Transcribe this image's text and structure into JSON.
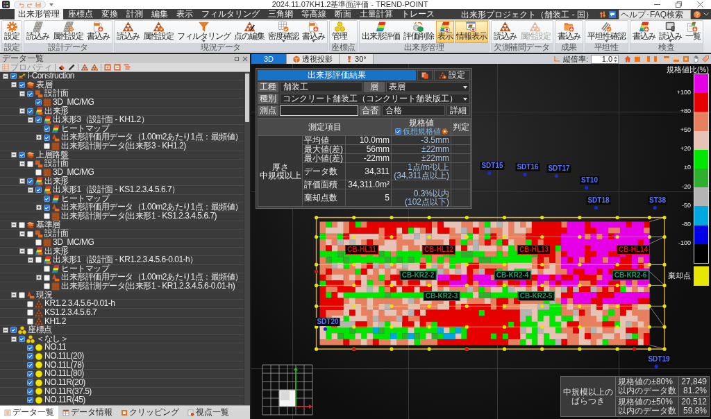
{
  "title_bar": {
    "title": "2024.11.07KH1.2基準面評価 - TREND-POINT"
  },
  "ribbon_tabs": [
    {
      "label": "出来形管理",
      "selected": true
    },
    {
      "label": "座標点",
      "selected": false
    },
    {
      "label": "変換",
      "selected": false
    },
    {
      "label": "計測",
      "selected": false
    },
    {
      "label": "編集",
      "selected": false
    },
    {
      "label": "表示",
      "selected": false
    },
    {
      "label": "フィルタリング",
      "selected": false
    },
    {
      "label": "三角網",
      "selected": false
    },
    {
      "label": "等高線",
      "selected": false
    },
    {
      "label": "断面",
      "selected": false
    },
    {
      "label": "土量計算",
      "selected": false
    },
    {
      "label": "トレース",
      "selected": false
    }
  ],
  "header_right": {
    "project": "出来形プロジェクト（舗装工 - 国）",
    "search": {
      "placeholder": "ヘルプ･FAQ検索"
    }
  },
  "ribbon_groups": [
    {
      "label": "設定",
      "buttons": [
        {
          "label": "設定",
          "on": false,
          "disabled": false,
          "dropdown": false
        }
      ]
    },
    {
      "label": "設計データ",
      "buttons": [
        {
          "label": "読込み",
          "on": false,
          "disabled": false,
          "dropdown": false
        },
        {
          "label": "属性設定",
          "on": false,
          "disabled": false,
          "dropdown": false
        },
        {
          "label": "書込み",
          "on": false,
          "disabled": false,
          "dropdown": false
        }
      ]
    },
    {
      "label": "現況データ",
      "buttons": [
        {
          "label": "読込み",
          "on": false,
          "disabled": false,
          "dropdown": false
        },
        {
          "label": "属性設定",
          "on": false,
          "disabled": false,
          "dropdown": false
        },
        {
          "label": "フィルタリング",
          "on": false,
          "disabled": false,
          "dropdown": true
        },
        {
          "label": "点の編集",
          "on": false,
          "disabled": false,
          "dropdown": false
        },
        {
          "label": "密度確認",
          "on": false,
          "disabled": false,
          "dropdown": true
        },
        {
          "label": "書込み",
          "on": false,
          "disabled": false,
          "dropdown": true
        }
      ]
    },
    {
      "label": "座標点",
      "buttons": [
        {
          "label": "管理",
          "on": false,
          "disabled": false,
          "dropdown": false
        }
      ]
    },
    {
      "label": "出来形管理",
      "buttons": [
        {
          "label": "出来形評価",
          "on": false,
          "disabled": false,
          "dropdown": false
        },
        {
          "label": "評価削除",
          "on": false,
          "disabled": false,
          "dropdown": false
        },
        {
          "label": "表示",
          "on": true,
          "disabled": false,
          "dropdown": false
        },
        {
          "label": "情報表示",
          "on": true,
          "disabled": false,
          "dropdown": false
        }
      ]
    },
    {
      "label": "欠測補間データ",
      "buttons": [
        {
          "label": "読込み",
          "on": false,
          "disabled": false,
          "dropdown": false
        },
        {
          "label": "属性設定",
          "on": false,
          "disabled": true,
          "dropdown": false
        }
      ]
    },
    {
      "label": "成果",
      "buttons": [
        {
          "label": "書込み",
          "on": false,
          "disabled": false,
          "dropdown": false
        }
      ]
    },
    {
      "label": "平坦性",
      "buttons": [
        {
          "label": "平坦性確認",
          "on": false,
          "disabled": false,
          "dropdown": true
        }
      ]
    },
    {
      "label": "検査",
      "buttons": [
        {
          "label": "書込み",
          "on": false,
          "disabled": false,
          "dropdown": false
        },
        {
          "label": "読込み",
          "on": false,
          "disabled": false,
          "dropdown": true
        },
        {
          "label": "一覧",
          "on": false,
          "disabled": false,
          "dropdown": false
        }
      ]
    }
  ],
  "data_panel": {
    "title": "データ一覧",
    "toolbar": {
      "label": "プロパティ",
      "disabled": true
    },
    "tree": [
      {
        "label": "i-Construction",
        "kind": "project",
        "checked": true,
        "expanded": true,
        "children": [
          {
            "label": "表層",
            "kind": "layer",
            "checked": true,
            "expanded": true,
            "children": [
              {
                "label": "設計面",
                "kind": "surface",
                "checked": true,
                "expanded": true,
                "children": [
                  {
                    "label": "3D_MC/MG",
                    "kind": "mesh",
                    "checked": true
                  }
                ]
              },
              {
                "label": "出来形",
                "kind": "asbuilt",
                "checked": true,
                "expanded": true,
                "children": [
                  {
                    "label": "出来形3（設計面 - KH1.2）",
                    "kind": "asbuilt",
                    "checked": true,
                    "expanded": true,
                    "children": [
                      {
                        "label": "ヒートマップ",
                        "kind": "heatmap",
                        "checked": true
                      },
                      {
                        "label": "出来形評価用データ（1.00m2あたり1点：最頻値）",
                        "kind": "evaldata",
                        "checked": true,
                        "expanded": false
                      },
                      {
                        "label": "出来形計測データ(出来形3 - KH1.2)",
                        "kind": "mesh",
                        "checked": false
                      }
                    ]
                  }
                ]
              }
            ]
          },
          {
            "label": "上層路盤",
            "kind": "layer",
            "checked": true,
            "expanded": true,
            "children": [
              {
                "label": "設計面",
                "kind": "surface",
                "checked": false,
                "expanded": true,
                "children": [
                  {
                    "label": "3D_MC/MG",
                    "kind": "mesh",
                    "checked": false
                  }
                ]
              },
              {
                "label": "出来形",
                "kind": "asbuilt",
                "checked": true,
                "expanded": true,
                "children": [
                  {
                    "label": "出来形1（設計面 - KS1.2.3.4.5.6.7）",
                    "kind": "asbuilt",
                    "checked": true,
                    "expanded": true,
                    "children": [
                      {
                        "label": "ヒートマップ",
                        "kind": "heatmap",
                        "checked": true
                      },
                      {
                        "label": "出来形評価用データ（1.00m2あたり1点：最頻値）",
                        "kind": "evaldata",
                        "checked": true,
                        "expanded": false
                      },
                      {
                        "label": "出来形計測データ(出来形1 - KS1.2.3.4.5.6.7)",
                        "kind": "mesh",
                        "checked": false
                      }
                    ]
                  }
                ]
              }
            ]
          },
          {
            "label": "基準層",
            "kind": "layer",
            "checked": false,
            "expanded": true,
            "children": [
              {
                "label": "設計面",
                "kind": "surface",
                "checked": false,
                "expanded": true,
                "children": [
                  {
                    "label": "3D_MC/MG",
                    "kind": "mesh",
                    "checked": false
                  }
                ]
              },
              {
                "label": "出来形",
                "kind": "asbuilt",
                "checked": false,
                "expanded": true,
                "children": [
                  {
                    "label": "出来形1（設計面 - KR1.2.3.4.5.6-0.01-h）",
                    "kind": "asbuilt",
                    "checked": false,
                    "expanded": true,
                    "children": [
                      {
                        "label": "ヒートマップ",
                        "kind": "heatmap",
                        "checked": false
                      },
                      {
                        "label": "出来形評価用データ（1.00m2あたり1点：最頻値）",
                        "kind": "evaldata",
                        "checked": false,
                        "expanded": false
                      },
                      {
                        "label": "出来形計測データ(出来形1 - KR1.2.3.4.5.6-0.01-h)",
                        "kind": "mesh",
                        "checked": false
                      }
                    ]
                  }
                ]
              }
            ]
          },
          {
            "label": "現況",
            "kind": "evaldata",
            "checked": false,
            "expanded": true,
            "children": [
              {
                "label": "KR1.2.3.4.5.6-0.01-h",
                "kind": "pointcloud",
                "checked": false
              },
              {
                "label": "KS1.2.3.4.5.6.7",
                "kind": "pointcloud",
                "checked": false
              },
              {
                "label": "KH1.2",
                "kind": "pointcloud",
                "checked": false
              }
            ]
          }
        ]
      },
      {
        "label": "座標点",
        "kind": "coordgroup",
        "checked": true,
        "expanded": true,
        "children": [
          {
            "label": "＜なし＞",
            "kind": "coordgroup",
            "checked": true,
            "expanded": true,
            "children": [
              {
                "label": "NO.11",
                "kind": "coord",
                "checked": true
              },
              {
                "label": "NO.11L(20)",
                "kind": "coord",
                "checked": true
              },
              {
                "label": "NO.11L(78)",
                "kind": "coord",
                "checked": true
              },
              {
                "label": "NO.11L(80)",
                "kind": "coord",
                "checked": true
              },
              {
                "label": "NO.11R(20)",
                "kind": "coord",
                "checked": true
              },
              {
                "label": "NO.11R(37.5)",
                "kind": "coord",
                "checked": true
              },
              {
                "label": "NO.11R(45)",
                "kind": "coord",
                "checked": true
              }
            ]
          }
        ]
      }
    ],
    "bottom_tabs": [
      {
        "label": "データ一覧",
        "selected": true
      },
      {
        "label": "データ情報",
        "selected": false
      },
      {
        "label": "クリッピング",
        "selected": false
      },
      {
        "label": "視点一覧",
        "selected": false
      }
    ]
  },
  "viewport": {
    "tabs": [
      {
        "label": "3D",
        "selected": true
      },
      {
        "label": "透視投影",
        "selected": false
      },
      {
        "label": "30°",
        "selected": false
      }
    ],
    "scale": {
      "label": "縦倍率:",
      "value": "1.0"
    },
    "evaluation": {
      "title": "出来形評価結果",
      "settings": "設定",
      "work_type": {
        "label": "工種",
        "value": "舗装工"
      },
      "layer": {
        "label": "層",
        "value": "表層"
      },
      "category": {
        "label": "種別",
        "value": "コンクリート舗装工（コンクリート舗装版工）"
      },
      "station": {
        "label": "測点"
      },
      "result": {
        "label": "合否",
        "value": "合格"
      },
      "detail": "詳細",
      "columns": {
        "item": "測定項目",
        "spec": "規格値",
        "judge": "判定"
      },
      "virtual_spec": {
        "label": "仮想規格値",
        "checked": true
      },
      "group": [
        "厚さ",
        "中規模以上"
      ],
      "rows": [
        {
          "item": "平均値",
          "value": "10.0mm",
          "spec": [
            "-3.5mm"
          ]
        },
        {
          "item": "最大値(差)",
          "value": "56mm",
          "spec": [
            "±22mm"
          ]
        },
        {
          "item": "最小値(差)",
          "value": "-22mm",
          "spec": [
            "±22mm"
          ]
        },
        {
          "item": "データ数",
          "value": "34,311",
          "spec": [
            "1点/m²以上",
            "(34,311点以上)"
          ]
        },
        {
          "item": "評価面積",
          "value": "34,311.0m²"
        },
        {
          "item": "棄却点数",
          "value": "5",
          "spec": [
            "0.3%以内",
            "(102点以下)"
          ]
        }
      ]
    },
    "points": [
      {
        "label": "SDT15"
      },
      {
        "label": "SDT16"
      },
      {
        "label": "SDT17"
      },
      {
        "label": "ST10"
      },
      {
        "label": "SDT18"
      },
      {
        "label": "ST38"
      },
      {
        "label": "SDT20"
      },
      {
        "label": "SDT19"
      }
    ],
    "line_labels": [
      {
        "label": "CB-HL11",
        "color": "#e01010"
      },
      {
        "label": "CB-HL12",
        "color": "#e01010"
      },
      {
        "label": "CB-HL13",
        "color": "#e01010"
      },
      {
        "label": "CB-HL14",
        "color": "#e01010"
      },
      {
        "label": "CB-KR2-2",
        "color": "#1f9e6e"
      },
      {
        "label": "CB-KR2-3",
        "color": "#1f9e6e"
      },
      {
        "label": "CB-KR2-4",
        "color": "#1f9e6e"
      },
      {
        "label": "CB-KR2-5",
        "color": "#1f9e6e"
      },
      {
        "label": "CB-KR2-6",
        "color": "#1f9e6e"
      }
    ],
    "legend": {
      "title": "規格値比(%)",
      "bands": [
        {
          "color": "#e600e6"
        },
        {
          "color": "#e60000"
        },
        {
          "color": "#e8805f"
        },
        {
          "color": "#e8c2b4"
        },
        {
          "color": "#00e600"
        },
        {
          "color": "#2eb02e"
        },
        {
          "color": "#b4b4b4"
        },
        {
          "color": "#00a8e0"
        },
        {
          "color": "#0000e6"
        },
        {
          "color": "#000000"
        }
      ],
      "ticks": [
        "+100",
        "+80",
        "+50",
        "+20",
        "±0",
        "-20",
        "-50",
        "-80",
        "-100"
      ],
      "rejected": {
        "label": "棄却点",
        "color": "#e6e600"
      }
    },
    "stats": {
      "title": [
        "中規模以上の",
        "ばらつき"
      ],
      "rows": [
        {
          "label": [
            "規格値の±80%",
            "以内のデータ数"
          ],
          "value": [
            "27,849",
            "81.2%"
          ]
        },
        {
          "label": [
            "規格値の±50%",
            "以内のデータ数"
          ],
          "value": [
            "20,512",
            "59.8%"
          ]
        }
      ]
    }
  }
}
